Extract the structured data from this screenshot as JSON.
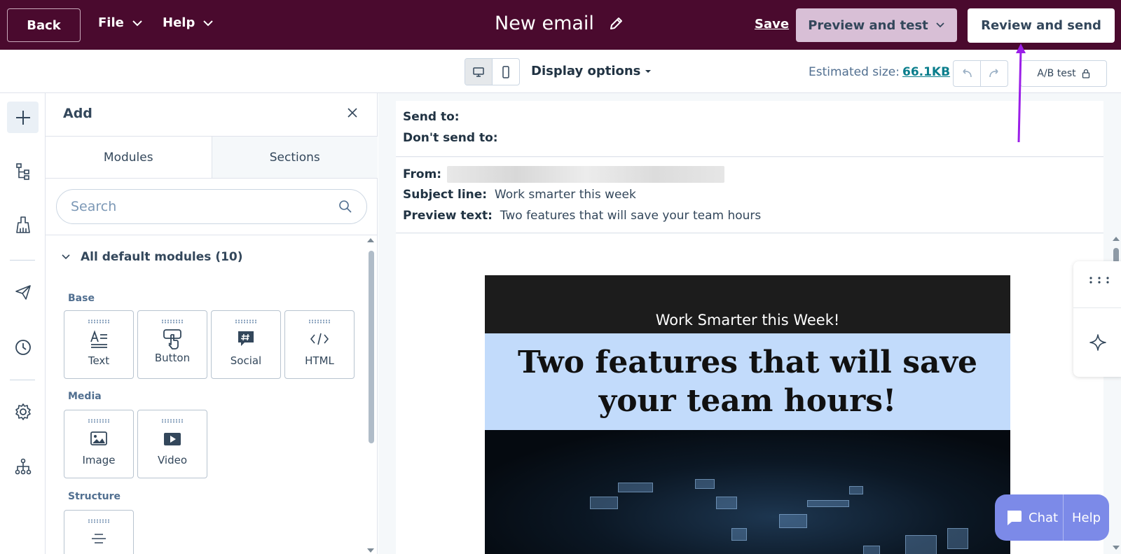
{
  "topbar": {
    "back_label": "Back",
    "file_label": "File",
    "help_label": "Help",
    "title": "New email",
    "save_label": "Save",
    "preview_label": "Preview and test",
    "review_label": "Review and send"
  },
  "toolbar": {
    "display_options_label": "Display options",
    "estimated_size_label": "Estimated size:",
    "estimated_size_value": "66.1KB",
    "ab_test_label": "A/B test"
  },
  "panel": {
    "title": "Add",
    "tabs": [
      {
        "label": "Modules"
      },
      {
        "label": "Sections"
      }
    ],
    "search_placeholder": "Search",
    "group_title": "All default modules (10)",
    "categories": [
      {
        "label": "Base",
        "modules": [
          {
            "label": "Text",
            "icon": "text-icon"
          },
          {
            "label": "Button",
            "icon": "button-icon"
          },
          {
            "label": "Social",
            "icon": "social-icon"
          },
          {
            "label": "HTML",
            "icon": "html-icon"
          }
        ]
      },
      {
        "label": "Media",
        "modules": [
          {
            "label": "Image",
            "icon": "image-icon"
          },
          {
            "label": "Video",
            "icon": "video-icon"
          }
        ]
      },
      {
        "label": "Structure",
        "modules": []
      }
    ]
  },
  "email_header": {
    "send_to_label": "Send to:",
    "dont_send_to_label": "Don't send to:",
    "from_label": "From:",
    "subject_label": "Subject line:",
    "subject_value": "Work smarter this week",
    "preview_label": "Preview text:",
    "preview_value": "Two features that will save your team hours"
  },
  "email_body": {
    "banner_text": "Work Smarter this Week!",
    "headline": "Two features that will save your team hours!"
  },
  "chat_widget": {
    "chat_label": "Chat",
    "help_label": "Help"
  },
  "colors": {
    "topbar_bg": "#4a0a2e",
    "preview_button_bg": "#d8bfd6",
    "headline_bg": "#c2dbfb",
    "accent_link": "#0a7e8c",
    "chat_widget": "#7c8ae8",
    "annotation_arrow": "#9b1fe8"
  }
}
